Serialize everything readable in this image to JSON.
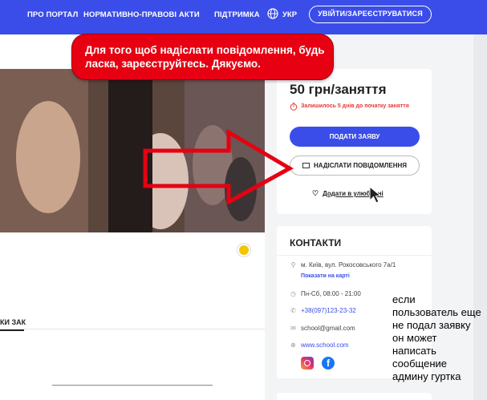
{
  "nav": {
    "about": "ПРО ПОРТАЛ",
    "legal": "НОРМАТИВНО-ПРАВОВІ АКТИ",
    "support": "ПІДТРИМКА",
    "lang": "УКР",
    "login": "УВІЙТИ/ЗАРЕЄСТРУВАТИСЯ"
  },
  "callout": {
    "text": "Для того щоб надіслати повідомлення, будь ласка, зареєструйтесь. Дякуємо."
  },
  "offer": {
    "price": "50 грн/заняття",
    "remaining": "Залишилось 5 днів до початку заняття",
    "apply_label": "ПОДАТИ ЗАЯВУ",
    "message_label": "НАДІСЛАТИ ПОВІДОМЛЕННЯ",
    "favorite_label": "Додати в улюблені"
  },
  "contacts": {
    "title": "КОНТАКТИ",
    "address": "м. Київ, вул. Рокосовського 7а/1",
    "show_map": "Показати на карті",
    "hours": "Пн-Сб, 08:00 - 21:00",
    "phone": "+38(097)123-23-32",
    "email": "school@gmail.com",
    "website": "www.school.com"
  },
  "content": {
    "tab_fragment": "КИ ЗАК"
  },
  "note": {
    "text": "если пользователь еще не подал заявку он может написать сообщение админу гуртка"
  },
  "colors": {
    "brand": "#3a4de9",
    "callout": "#e60012",
    "warning": "#e53935"
  }
}
